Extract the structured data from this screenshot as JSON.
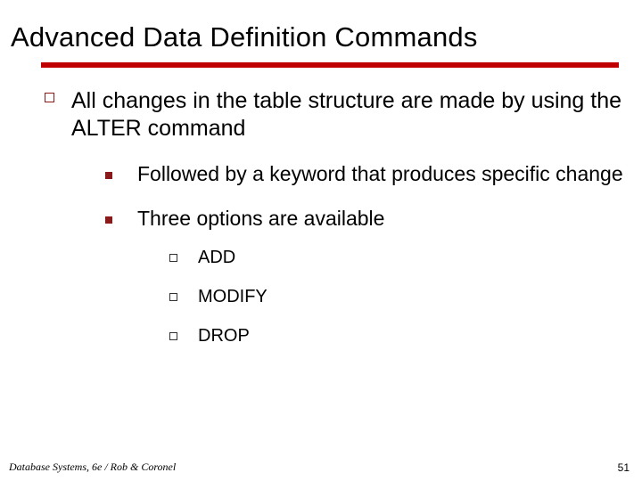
{
  "title": "Advanced Data Definition Commands",
  "lvl1": {
    "text": "All changes in the table structure are made by using the ALTER command"
  },
  "lvl2a": {
    "text": "Followed by a keyword that produces specific change"
  },
  "lvl2b": {
    "text": "Three options are available"
  },
  "lvl3": {
    "a": "ADD",
    "b": "MODIFY",
    "c": "DROP"
  },
  "footer": {
    "left": "Database Systems, 6e / Rob & Coronel",
    "right": "51"
  }
}
